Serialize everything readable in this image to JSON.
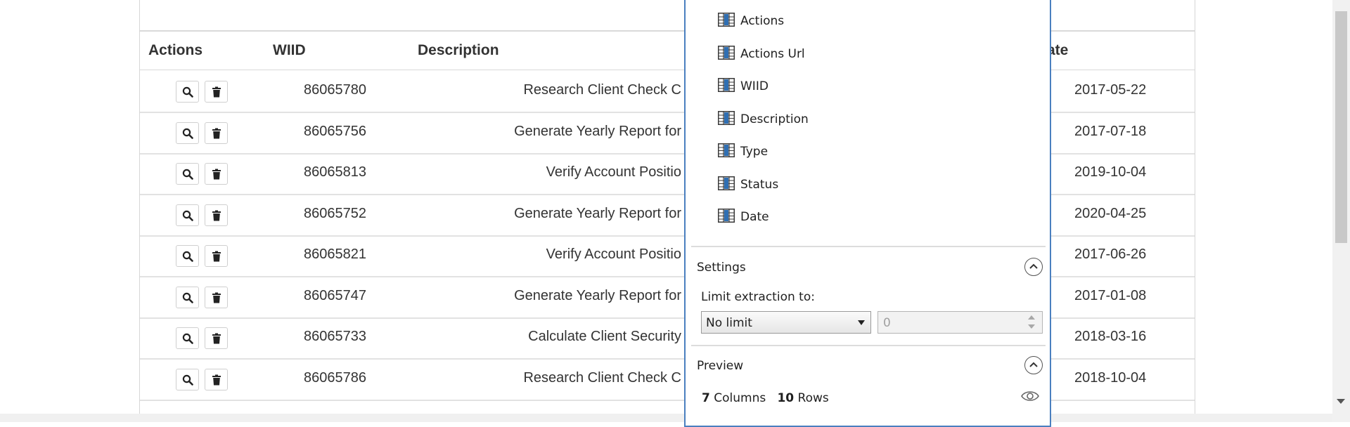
{
  "table": {
    "headers": {
      "actions": "Actions",
      "wiid": "WIID",
      "description": "Description",
      "date": "ate"
    },
    "rows": [
      {
        "wiid": "86065780",
        "description": "Research Client Check C",
        "date": "2017-05-22"
      },
      {
        "wiid": "86065756",
        "description": "Generate Yearly Report for",
        "date": "2017-07-18"
      },
      {
        "wiid": "86065813",
        "description": "Verify Account Positio",
        "date": "2019-10-04"
      },
      {
        "wiid": "86065752",
        "description": "Generate Yearly Report for",
        "date": "2020-04-25"
      },
      {
        "wiid": "86065821",
        "description": "Verify Account Positio",
        "date": "2017-06-26"
      },
      {
        "wiid": "86065747",
        "description": "Generate Yearly Report for",
        "date": "2017-01-08"
      },
      {
        "wiid": "86065733",
        "description": "Calculate Client Security",
        "date": "2018-03-16"
      },
      {
        "wiid": "86065786",
        "description": "Research Client Check C",
        "date": "2018-10-04"
      }
    ],
    "row_icons": {
      "view": "search-icon",
      "delete": "trash-icon"
    }
  },
  "dialog": {
    "fields": [
      {
        "label": "Actions",
        "icon": "column-icon"
      },
      {
        "label": "Actions Url",
        "icon": "column-icon"
      },
      {
        "label": "WIID",
        "icon": "column-icon"
      },
      {
        "label": "Description",
        "icon": "column-icon"
      },
      {
        "label": "Type",
        "icon": "column-icon"
      },
      {
        "label": "Status",
        "icon": "column-icon"
      },
      {
        "label": "Date",
        "icon": "column-icon"
      }
    ],
    "settings": {
      "title": "Settings",
      "limit_label": "Limit extraction to:",
      "limit_select_value": "No limit",
      "limit_number_value": "0"
    },
    "preview": {
      "title": "Preview",
      "columns_count": "7",
      "columns_label": "Columns",
      "rows_count": "10",
      "rows_label": "Rows"
    }
  },
  "colors": {
    "dialog_border": "#4a7fbf",
    "icon_blue": "#2f6fb3"
  }
}
